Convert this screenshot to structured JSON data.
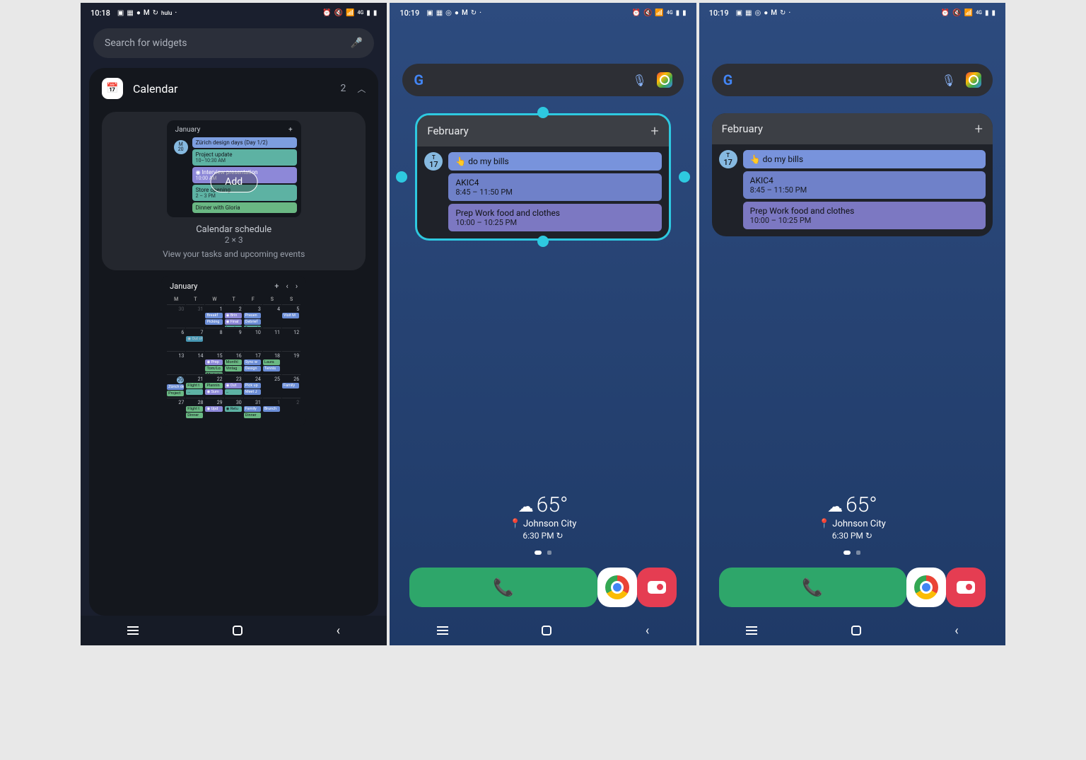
{
  "p1": {
    "time": "10:18",
    "search_placeholder": "Search for widgets",
    "section_title": "Calendar",
    "section_count": "2",
    "add_btn": "Add",
    "sched_month": "January",
    "sched_date_badge": {
      "dow": "M",
      "day": "20"
    },
    "sched_events": [
      {
        "cls": "blue",
        "title": "Zürich design days (Day 1/2)",
        "sub": ""
      },
      {
        "cls": "teal",
        "title": "Project update",
        "sub": "10–10:30 AM"
      },
      {
        "cls": "purple",
        "title": "◉ Interview presentation",
        "sub": "10:00 AM"
      },
      {
        "cls": "teal",
        "title": "Store opening",
        "sub": "2 – 3 PM"
      },
      {
        "cls": "green",
        "title": "Dinner with Gloria",
        "sub": ""
      }
    ],
    "sched_name": "Calendar schedule",
    "sched_size": "2 × 3",
    "sched_desc": "View your tasks and upcoming events",
    "month_label": "January",
    "dow": [
      "M",
      "T",
      "W",
      "T",
      "F",
      "S",
      "S"
    ]
  },
  "home": {
    "time": "10:19",
    "month": "February",
    "date_badge": {
      "dow": "T",
      "day": "17"
    },
    "events": [
      {
        "cls": "blue",
        "line1": "👆 do my bills",
        "line2": ""
      },
      {
        "cls": "blue2",
        "line1": "AKIC4",
        "line2": "8:45 – 11:50 PM"
      },
      {
        "cls": "purp",
        "line1": "Prep Work food and clothes",
        "line2": "10:00 – 10:25 PM"
      }
    ],
    "temp": "65°",
    "city": "Johnson City",
    "clock": "6:30 PM"
  }
}
